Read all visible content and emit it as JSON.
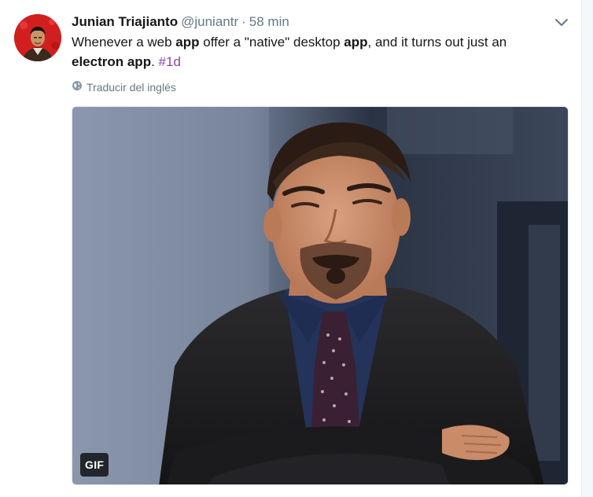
{
  "tweet": {
    "author": {
      "fullname": "Junian Triajianto",
      "handle": "@juniantr",
      "separator": "·",
      "time": "58 min"
    },
    "text_parts": {
      "p1": "Whenever a web ",
      "p2": "app",
      "p3": " offer a \"native\" desktop ",
      "p4": "app",
      "p5": ", and it turns out just an ",
      "p6": "electron app",
      "p7": ". ",
      "hashtag": "#1d"
    },
    "translate_label": "Traducir del inglés",
    "media": {
      "badge": "GIF"
    }
  },
  "icons": {
    "caret": "chevron-down-icon",
    "translate": "globe-icon"
  },
  "colors": {
    "name": "#14171a",
    "secondary": "#657786",
    "hashtag": "#8e44ad",
    "background": "#ffffff"
  }
}
